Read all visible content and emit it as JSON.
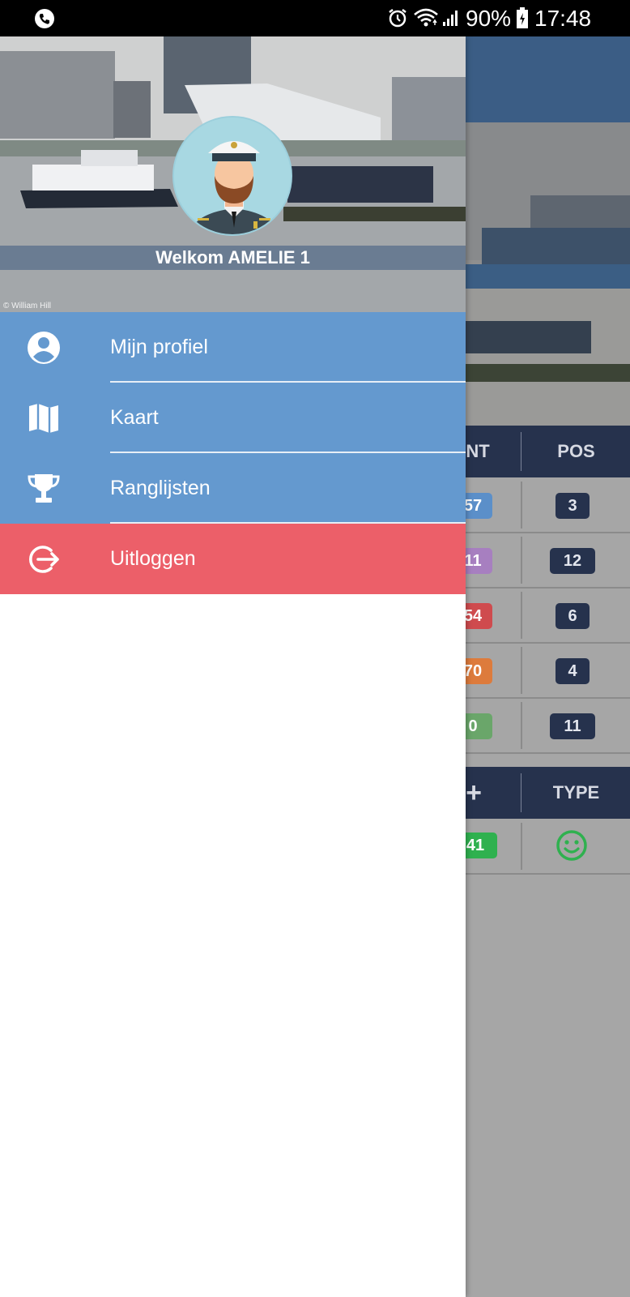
{
  "status_bar": {
    "battery_percent": "90%",
    "time": "17:48",
    "icons": [
      "call-icon",
      "alarm-icon",
      "wifi-icon",
      "signal-icon",
      "battery-icon"
    ]
  },
  "drawer": {
    "welcome": "Welkom AMELIE 1",
    "photo_credit": "© William Hill",
    "menu": [
      {
        "label": "Mijn profiel",
        "icon": "account-circle-icon"
      },
      {
        "label": "Kaart",
        "icon": "map-icon"
      },
      {
        "label": "Ranglijsten",
        "icon": "trophy-icon"
      },
      {
        "label": "Uitloggen",
        "icon": "logout-icon"
      }
    ]
  },
  "background_table": {
    "header1": {
      "partial": "NT",
      "pos": "POS"
    },
    "rows": [
      {
        "partial_value": "57",
        "color": "#5b8fc9",
        "pos": "3"
      },
      {
        "partial_value": "11",
        "color": "#a77fc0",
        "pos": "12"
      },
      {
        "partial_value": "54",
        "color": "#cf4b4e",
        "pos": "6"
      },
      {
        "partial_value": "70",
        "color": "#dd7b3c",
        "pos": "4"
      },
      {
        "partial_value": "0",
        "color": "#6aa66a",
        "pos": "11"
      }
    ],
    "header2": {
      "partial": "+",
      "type": "TYPE"
    },
    "row2": {
      "partial_value": "41",
      "color": "#2fb14f",
      "type_icon": "smiley-icon"
    }
  },
  "colors": {
    "menu_blue": "#6499cf",
    "logout_red": "#ec5f69",
    "table_header": "#26324d",
    "app_header": "#3b5d85"
  }
}
